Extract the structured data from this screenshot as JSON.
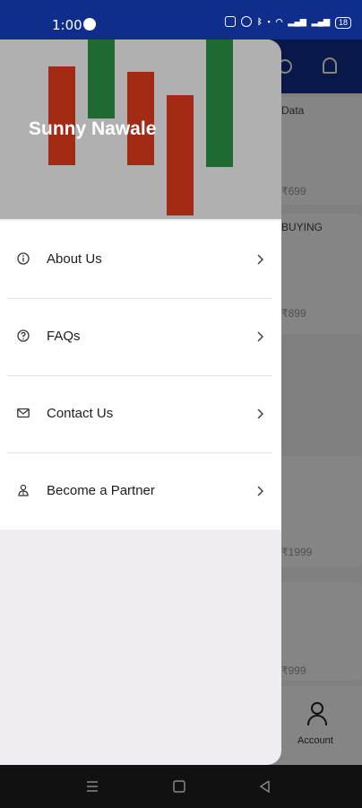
{
  "status_bar": {
    "time": "1:00",
    "battery": "18"
  },
  "drawer": {
    "user_name": "Sunny Nawale",
    "items": [
      {
        "label": "About Us",
        "icon": "info-icon"
      },
      {
        "label": "FAQs",
        "icon": "question-icon"
      },
      {
        "label": "Contact Us",
        "icon": "mail-icon"
      },
      {
        "label": "Become a Partner",
        "icon": "partner-icon"
      }
    ]
  },
  "background": {
    "card_title": "Data",
    "buying_label": "BUYING",
    "prices": [
      "₹699",
      "₹899",
      "₹1999",
      "₹999"
    ],
    "bottom_nav_account": "Account"
  },
  "colors": {
    "primary": "#0f2e8c",
    "candle_red": "#a32a14",
    "candle_green": "#1f6a33"
  }
}
